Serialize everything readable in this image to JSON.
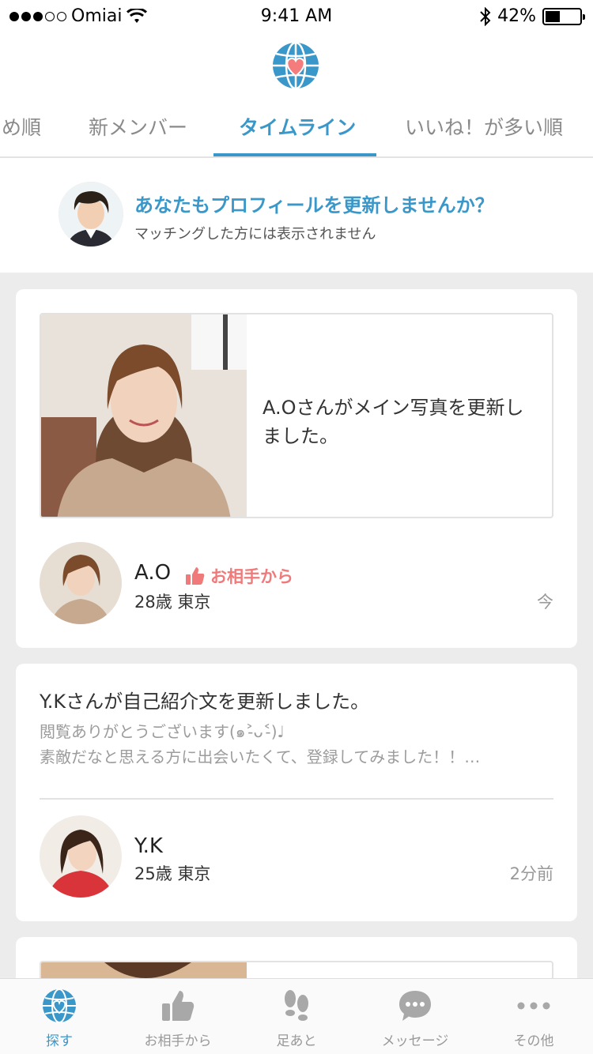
{
  "status": {
    "carrier": "Omiai",
    "time": "9:41 AM",
    "battery": "42%",
    "battery_level": 0.42
  },
  "tabs": [
    {
      "label": "め順"
    },
    {
      "label": "新メンバー"
    },
    {
      "label": "タイムライン"
    },
    {
      "label": "いいね！が多い順"
    }
  ],
  "promo": {
    "title": "あなたもプロフィールを更新しませんか？",
    "subtitle": "マッチングした方には表示されません"
  },
  "feed": [
    {
      "message": "A.Oさんがメイン写真を更新しました。",
      "name": "A.O",
      "badge": "お相手から",
      "meta": "28歳 東京",
      "time": "今"
    },
    {
      "title": "Y.Kさんが自己紹介文を更新しました。",
      "body_line1": "閲覧ありがとうございます(๑˃̵ᴗ˂̵)♩",
      "body_line2": "素敵だなと思える方に出会いたくて、登録してみました！！…",
      "name": "Y.K",
      "meta": "25歳 東京",
      "time": "2分前"
    }
  ],
  "tabbar": [
    {
      "label": "探す",
      "icon": "globe-heart-icon"
    },
    {
      "label": "お相手から",
      "icon": "thumbs-up-icon"
    },
    {
      "label": "足あと",
      "icon": "footprints-icon"
    },
    {
      "label": "メッセージ",
      "icon": "chat-bubble-icon"
    },
    {
      "label": "その他",
      "icon": "more-dots-icon"
    }
  ],
  "colors": {
    "accent": "#3a97c9",
    "like": "#f07a7a",
    "background": "#ececec"
  }
}
